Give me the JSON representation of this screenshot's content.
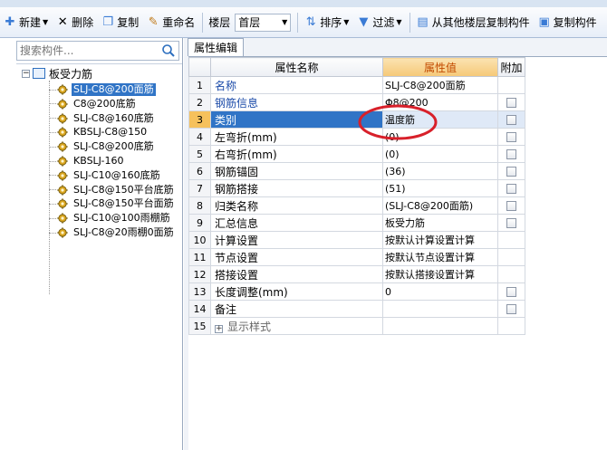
{
  "toolbar": {
    "new_label": "新建",
    "delete_label": "删除",
    "copy_label": "复制",
    "rename_label": "重命名",
    "floor_label": "楼层",
    "floor_value": "首层",
    "sort_label": "排序",
    "filter_label": "过滤",
    "copy_from_floor_label": "从其他楼层复制构件",
    "copy_to_label": "复制构件"
  },
  "search": {
    "placeholder": "搜索构件..."
  },
  "tree": {
    "root_label": "板受力筋",
    "items": [
      {
        "label": "SLJ-C8@200面筋",
        "selected": true
      },
      {
        "label": "C8@200底筋"
      },
      {
        "label": "SLJ-C8@160底筋"
      },
      {
        "label": "KBSLJ-C8@150"
      },
      {
        "label": "SLJ-C8@200底筋"
      },
      {
        "label": "KBSLJ-160"
      },
      {
        "label": "SLJ-C10@160底筋"
      },
      {
        "label": "SLJ-C8@150平台底筋"
      },
      {
        "label": "SLJ-C8@150平台面筋"
      },
      {
        "label": "SLJ-C10@100雨棚筋"
      },
      {
        "label": "SLJ-C8@20雨棚0面筋"
      }
    ]
  },
  "panel": {
    "tab_label": "属性编辑",
    "columns": {
      "name": "属性名称",
      "value": "属性值",
      "extra": "附加"
    },
    "rows": [
      {
        "num": "1",
        "name": "名称",
        "value": "SLJ-C8@200面筋",
        "checkbox": false
      },
      {
        "num": "2",
        "name": "钢筋信息",
        "value": "Φ8@200",
        "checkbox": true
      },
      {
        "num": "3",
        "name": "类别",
        "value": "温度筋",
        "checkbox": true,
        "selected": true
      },
      {
        "num": "4",
        "name": "左弯折(mm)",
        "value": "(0)",
        "checkbox": true
      },
      {
        "num": "5",
        "name": "右弯折(mm)",
        "value": "(0)",
        "checkbox": true
      },
      {
        "num": "6",
        "name": "钢筋锚固",
        "value": "(36)",
        "checkbox": true
      },
      {
        "num": "7",
        "name": "钢筋搭接",
        "value": "(51)",
        "checkbox": true
      },
      {
        "num": "8",
        "name": "归类名称",
        "value": "(SLJ-C8@200面筋)",
        "checkbox": true
      },
      {
        "num": "9",
        "name": "汇总信息",
        "value": "板受力筋",
        "checkbox": true
      },
      {
        "num": "10",
        "name": "计算设置",
        "value": "按默认计算设置计算",
        "checkbox": false
      },
      {
        "num": "11",
        "name": "节点设置",
        "value": "按默认节点设置计算",
        "checkbox": false
      },
      {
        "num": "12",
        "name": "搭接设置",
        "value": "按默认搭接设置计算",
        "checkbox": false
      },
      {
        "num": "13",
        "name": "长度调整(mm)",
        "value": "0",
        "checkbox": true
      },
      {
        "num": "14",
        "name": "备注",
        "value": "",
        "checkbox": true
      },
      {
        "num": "15",
        "name": "显示样式",
        "value": "",
        "checkbox": false,
        "group": true
      }
    ]
  },
  "colors": {
    "selection": "#3074c6",
    "value_header": "#f5c877",
    "annotation": "#d8202a"
  }
}
